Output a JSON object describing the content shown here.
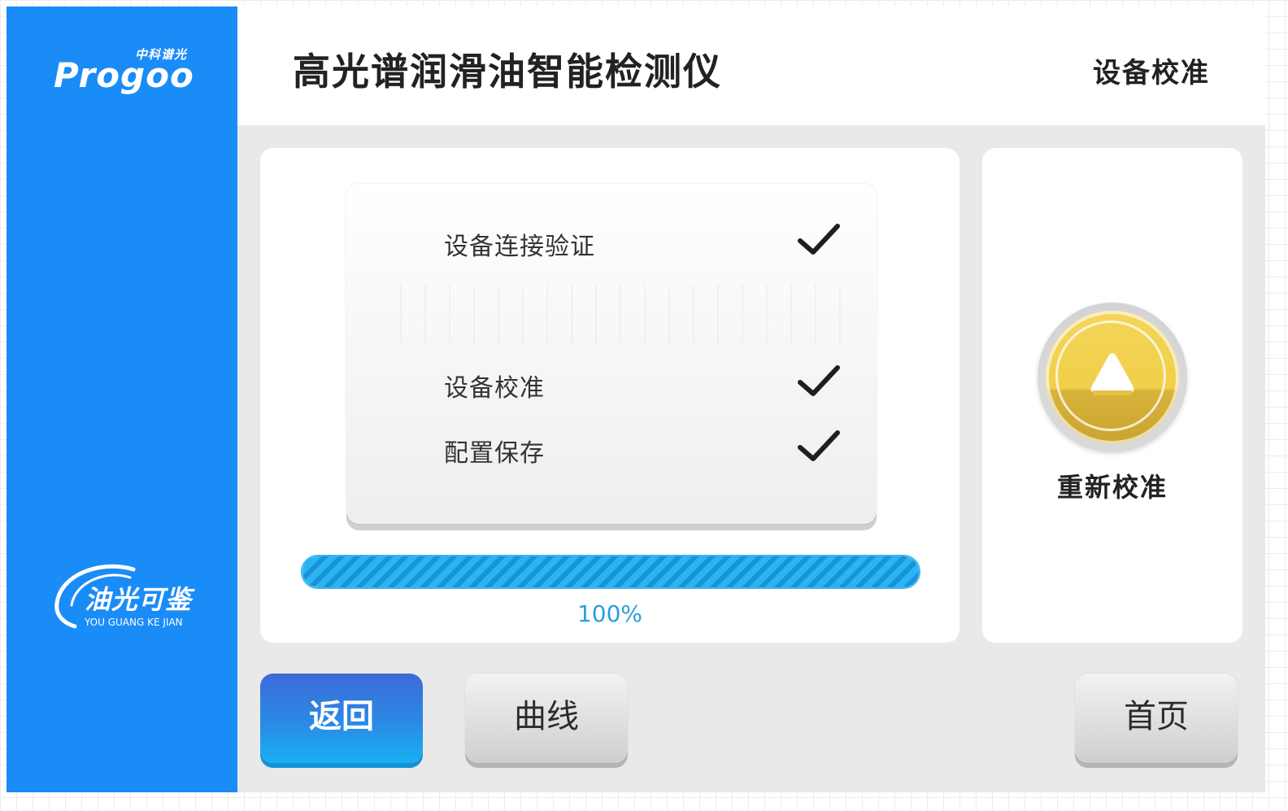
{
  "sidebar": {
    "brand": {
      "subtitle": "中科谱光",
      "wordmark": "Progoo"
    },
    "product": {
      "title": "油光可鉴",
      "subtitle": "YOU GUANG KE JIAN"
    }
  },
  "header": {
    "app_title": "高光谱润滑油智能检测仪",
    "page_title": "设备校准"
  },
  "steps": [
    {
      "label": "设备连接验证",
      "status": "done",
      "icon": "check-icon"
    },
    {
      "label": "设备校准",
      "status": "done",
      "icon": "check-icon"
    },
    {
      "label": "配置保存",
      "status": "done",
      "icon": "check-icon"
    }
  ],
  "progress": {
    "value": 1.0,
    "text": "100%"
  },
  "side": {
    "recalibrate_label": "重新校准",
    "recalibrate_icon": "up-arrow-icon"
  },
  "buttons": {
    "back": "返回",
    "curve": "曲线",
    "home": "首页"
  },
  "colors": {
    "sidebar": "#1a8cf8",
    "accent": "#2a9fdc",
    "recalibrate": "#f0cf4a"
  }
}
